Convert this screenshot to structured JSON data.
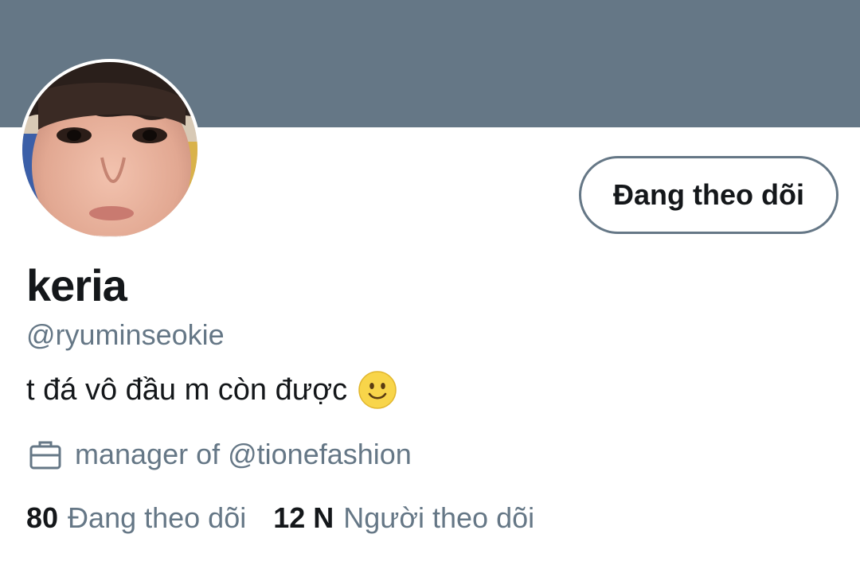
{
  "profile": {
    "display_name": "keria",
    "handle": "@ryuminseokie",
    "bio": "t đá vô đầu m còn được",
    "bio_emoji": "slightly-smiling-face",
    "job": "manager of @tionefashion",
    "follow_button_label": "Đang theo dõi"
  },
  "stats": {
    "following_count": "80",
    "following_label": "Đang theo dõi",
    "followers_count": "12 N",
    "followers_label": "Người theo dõi"
  },
  "colors": {
    "banner": "#657786",
    "secondary_text": "#657786",
    "primary_text": "#14171a",
    "background": "#ffffff"
  },
  "icons": {
    "job": "briefcase-icon",
    "emoji": "smiley-emoji-icon"
  }
}
